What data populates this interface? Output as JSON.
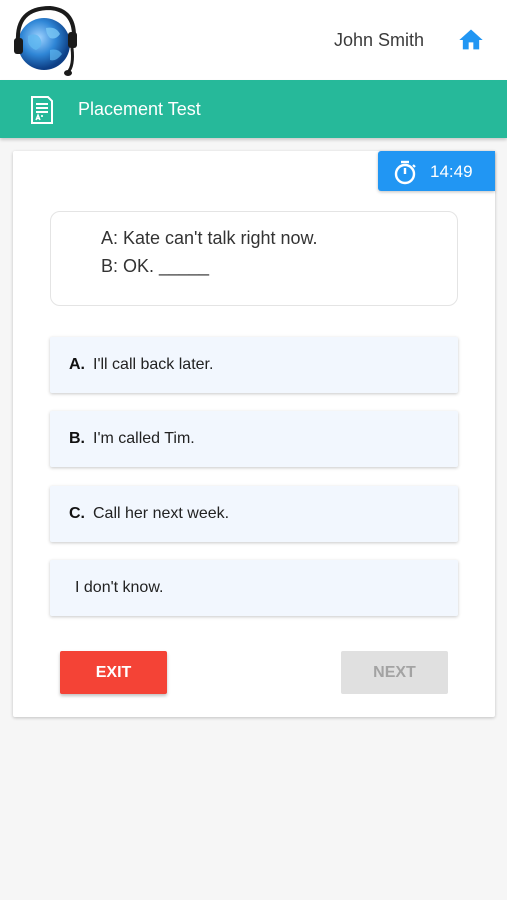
{
  "header": {
    "user_name": "John Smith",
    "logo_icon": "globe-headset-logo",
    "home_icon": "home-icon"
  },
  "title_bar": {
    "title": "Placement Test",
    "icon": "test-paper-icon",
    "color": "#26b99a"
  },
  "timer": {
    "value": "14:49",
    "icon": "stopwatch-icon",
    "color": "#2196f3"
  },
  "question": {
    "line_a": "A: Kate can't talk right now.",
    "line_b": "B: OK. _____"
  },
  "options": [
    {
      "letter": "A.",
      "text": "I'll call back later."
    },
    {
      "letter": "B.",
      "text": "I'm called Tim."
    },
    {
      "letter": "C.",
      "text": "Call her next week."
    },
    {
      "letter": "",
      "text": "I don't know."
    }
  ],
  "buttons": {
    "exit_label": "EXIT",
    "next_label": "NEXT",
    "exit_color": "#f44336",
    "next_state": "disabled"
  }
}
